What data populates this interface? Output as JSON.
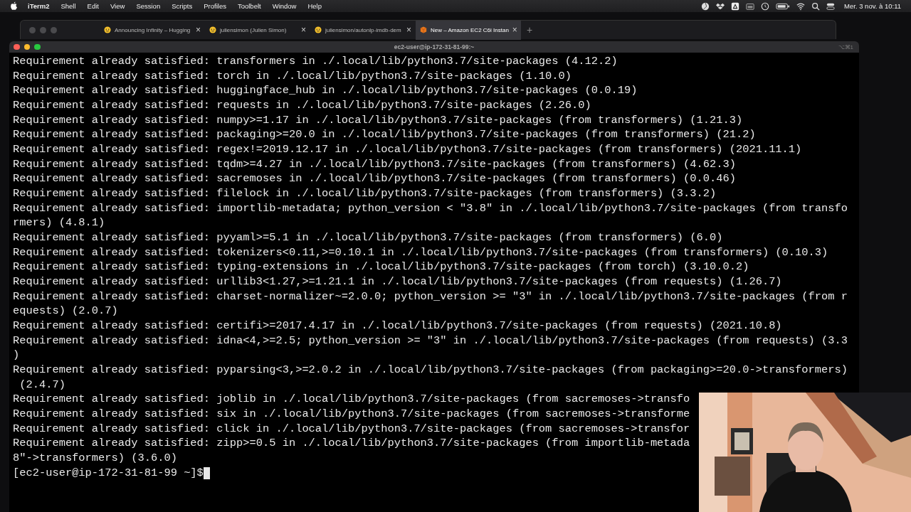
{
  "menubar": {
    "app": "iTerm2",
    "items": [
      "Shell",
      "Edit",
      "View",
      "Session",
      "Scripts",
      "Profiles",
      "Toolbelt",
      "Window",
      "Help"
    ],
    "clock": "Mer. 3 nov. à  10:11"
  },
  "browser": {
    "tabs": [
      {
        "title": "Announcing Infinity – Hugging",
        "close": "×",
        "selected": false
      },
      {
        "title": "juliensimon (Julien Simon)",
        "close": "×",
        "selected": false
      },
      {
        "title": "juliensimon/autonlp-imdb-dem",
        "close": "×",
        "selected": false
      },
      {
        "title": "New – Amazon EC2 C6i Instan",
        "close": "×",
        "selected": true
      }
    ],
    "new_tab": "+"
  },
  "terminal": {
    "title": "ec2-user@ip-172-31-81-99:~",
    "shortcut": "⌥⌘1",
    "lines": [
      "Requirement already satisfied: transformers in ./.local/lib/python3.7/site-packages (4.12.2)",
      "Requirement already satisfied: torch in ./.local/lib/python3.7/site-packages (1.10.0)",
      "Requirement already satisfied: huggingface_hub in ./.local/lib/python3.7/site-packages (0.0.19)",
      "Requirement already satisfied: requests in ./.local/lib/python3.7/site-packages (2.26.0)",
      "Requirement already satisfied: numpy>=1.17 in ./.local/lib/python3.7/site-packages (from transformers) (1.21.3)",
      "Requirement already satisfied: packaging>=20.0 in ./.local/lib/python3.7/site-packages (from transformers) (21.2)",
      "Requirement already satisfied: regex!=2019.12.17 in ./.local/lib/python3.7/site-packages (from transformers) (2021.11.1)",
      "Requirement already satisfied: tqdm>=4.27 in ./.local/lib/python3.7/site-packages (from transformers) (4.62.3)",
      "Requirement already satisfied: sacremoses in ./.local/lib/python3.7/site-packages (from transformers) (0.0.46)",
      "Requirement already satisfied: filelock in ./.local/lib/python3.7/site-packages (from transformers) (3.3.2)",
      "Requirement already satisfied: importlib-metadata; python_version < \"3.8\" in ./.local/lib/python3.7/site-packages (from transfo",
      "rmers) (4.8.1)",
      "Requirement already satisfied: pyyaml>=5.1 in ./.local/lib/python3.7/site-packages (from transformers) (6.0)",
      "Requirement already satisfied: tokenizers<0.11,>=0.10.1 in ./.local/lib/python3.7/site-packages (from transformers) (0.10.3)",
      "Requirement already satisfied: typing-extensions in ./.local/lib/python3.7/site-packages (from torch) (3.10.0.2)",
      "Requirement already satisfied: urllib3<1.27,>=1.21.1 in ./.local/lib/python3.7/site-packages (from requests) (1.26.7)",
      "Requirement already satisfied: charset-normalizer~=2.0.0; python_version >= \"3\" in ./.local/lib/python3.7/site-packages (from r",
      "equests) (2.0.7)",
      "Requirement already satisfied: certifi>=2017.4.17 in ./.local/lib/python3.7/site-packages (from requests) (2021.10.8)",
      "Requirement already satisfied: idna<4,>=2.5; python_version >= \"3\" in ./.local/lib/python3.7/site-packages (from requests) (3.3",
      ")",
      "Requirement already satisfied: pyparsing<3,>=2.0.2 in ./.local/lib/python3.7/site-packages (from packaging>=20.0->transformers)",
      " (2.4.7)",
      "Requirement already satisfied: joblib in ./.local/lib/python3.7/site-packages (from sacremoses->transfo",
      "Requirement already satisfied: six in ./.local/lib/python3.7/site-packages (from sacremoses->transforme",
      "Requirement already satisfied: click in ./.local/lib/python3.7/site-packages (from sacremoses->transfor",
      "Requirement already satisfied: zipp>=0.5 in ./.local/lib/python3.7/site-packages (from importlib-metada",
      "8\"->transformers) (3.6.0)"
    ],
    "prompt": "[ec2-user@ip-172-31-81-99 ~]$"
  }
}
